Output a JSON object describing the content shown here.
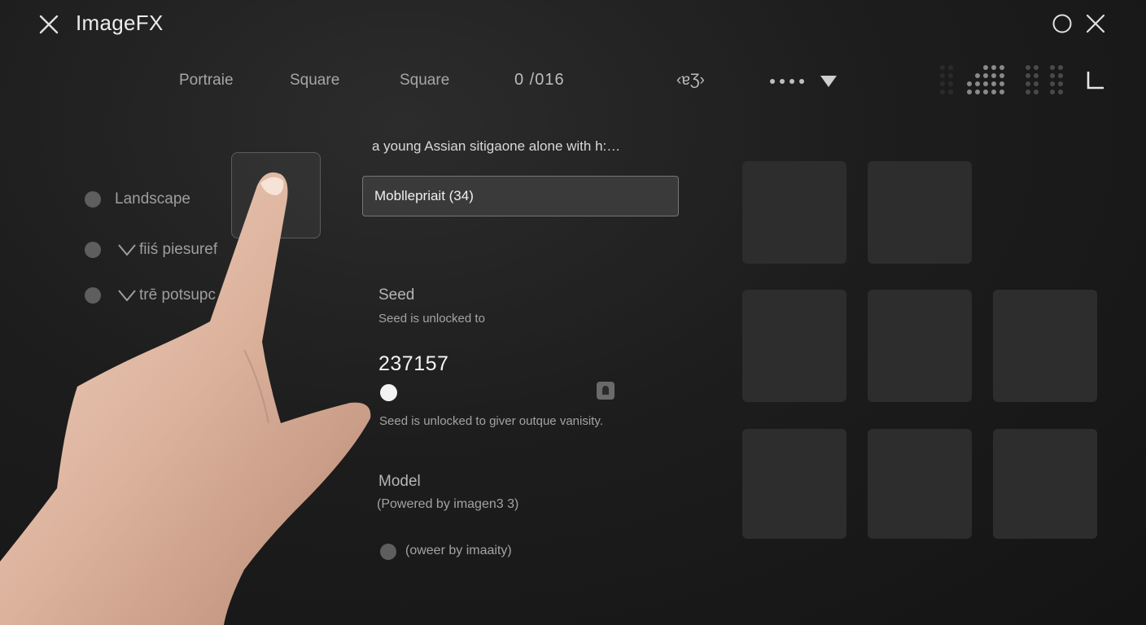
{
  "app": {
    "title": "ImageFX"
  },
  "toolbar": {
    "items": [
      "Portraie",
      "Square",
      "Square"
    ],
    "counter": "0 /016",
    "code_label": "‹ɐƷ›"
  },
  "left_panel": {
    "options": [
      {
        "label": "Landscape"
      },
      {
        "label": "fiiś piesuref"
      },
      {
        "label": "trē potsupc"
      }
    ]
  },
  "prompt": {
    "text": "a young Assian sitigaone alone with h:…"
  },
  "aspect_field": {
    "value": "Mobllepriait (34)"
  },
  "seed": {
    "title": "Seed",
    "subtitle": "Seed is unlocked to",
    "value": "237157",
    "hint": "Seed is unlocked to giver outque vanisity."
  },
  "model": {
    "title": "Model",
    "subtitle": "(Powered by imagen3 3)",
    "option_label": "(oweer by imaaity)"
  },
  "colors": {
    "background": "#1d1d1d",
    "tile": "#2d2d2d",
    "field_bg": "#3a3a3a",
    "text_primary": "#ececec",
    "text_muted": "#9e9e9e"
  },
  "icons": [
    "close-icon",
    "circle-icon",
    "window-close-icon",
    "chevron-down-icon",
    "caret-down-icon",
    "grid-icon",
    "corner-icon",
    "lock-icon"
  ]
}
